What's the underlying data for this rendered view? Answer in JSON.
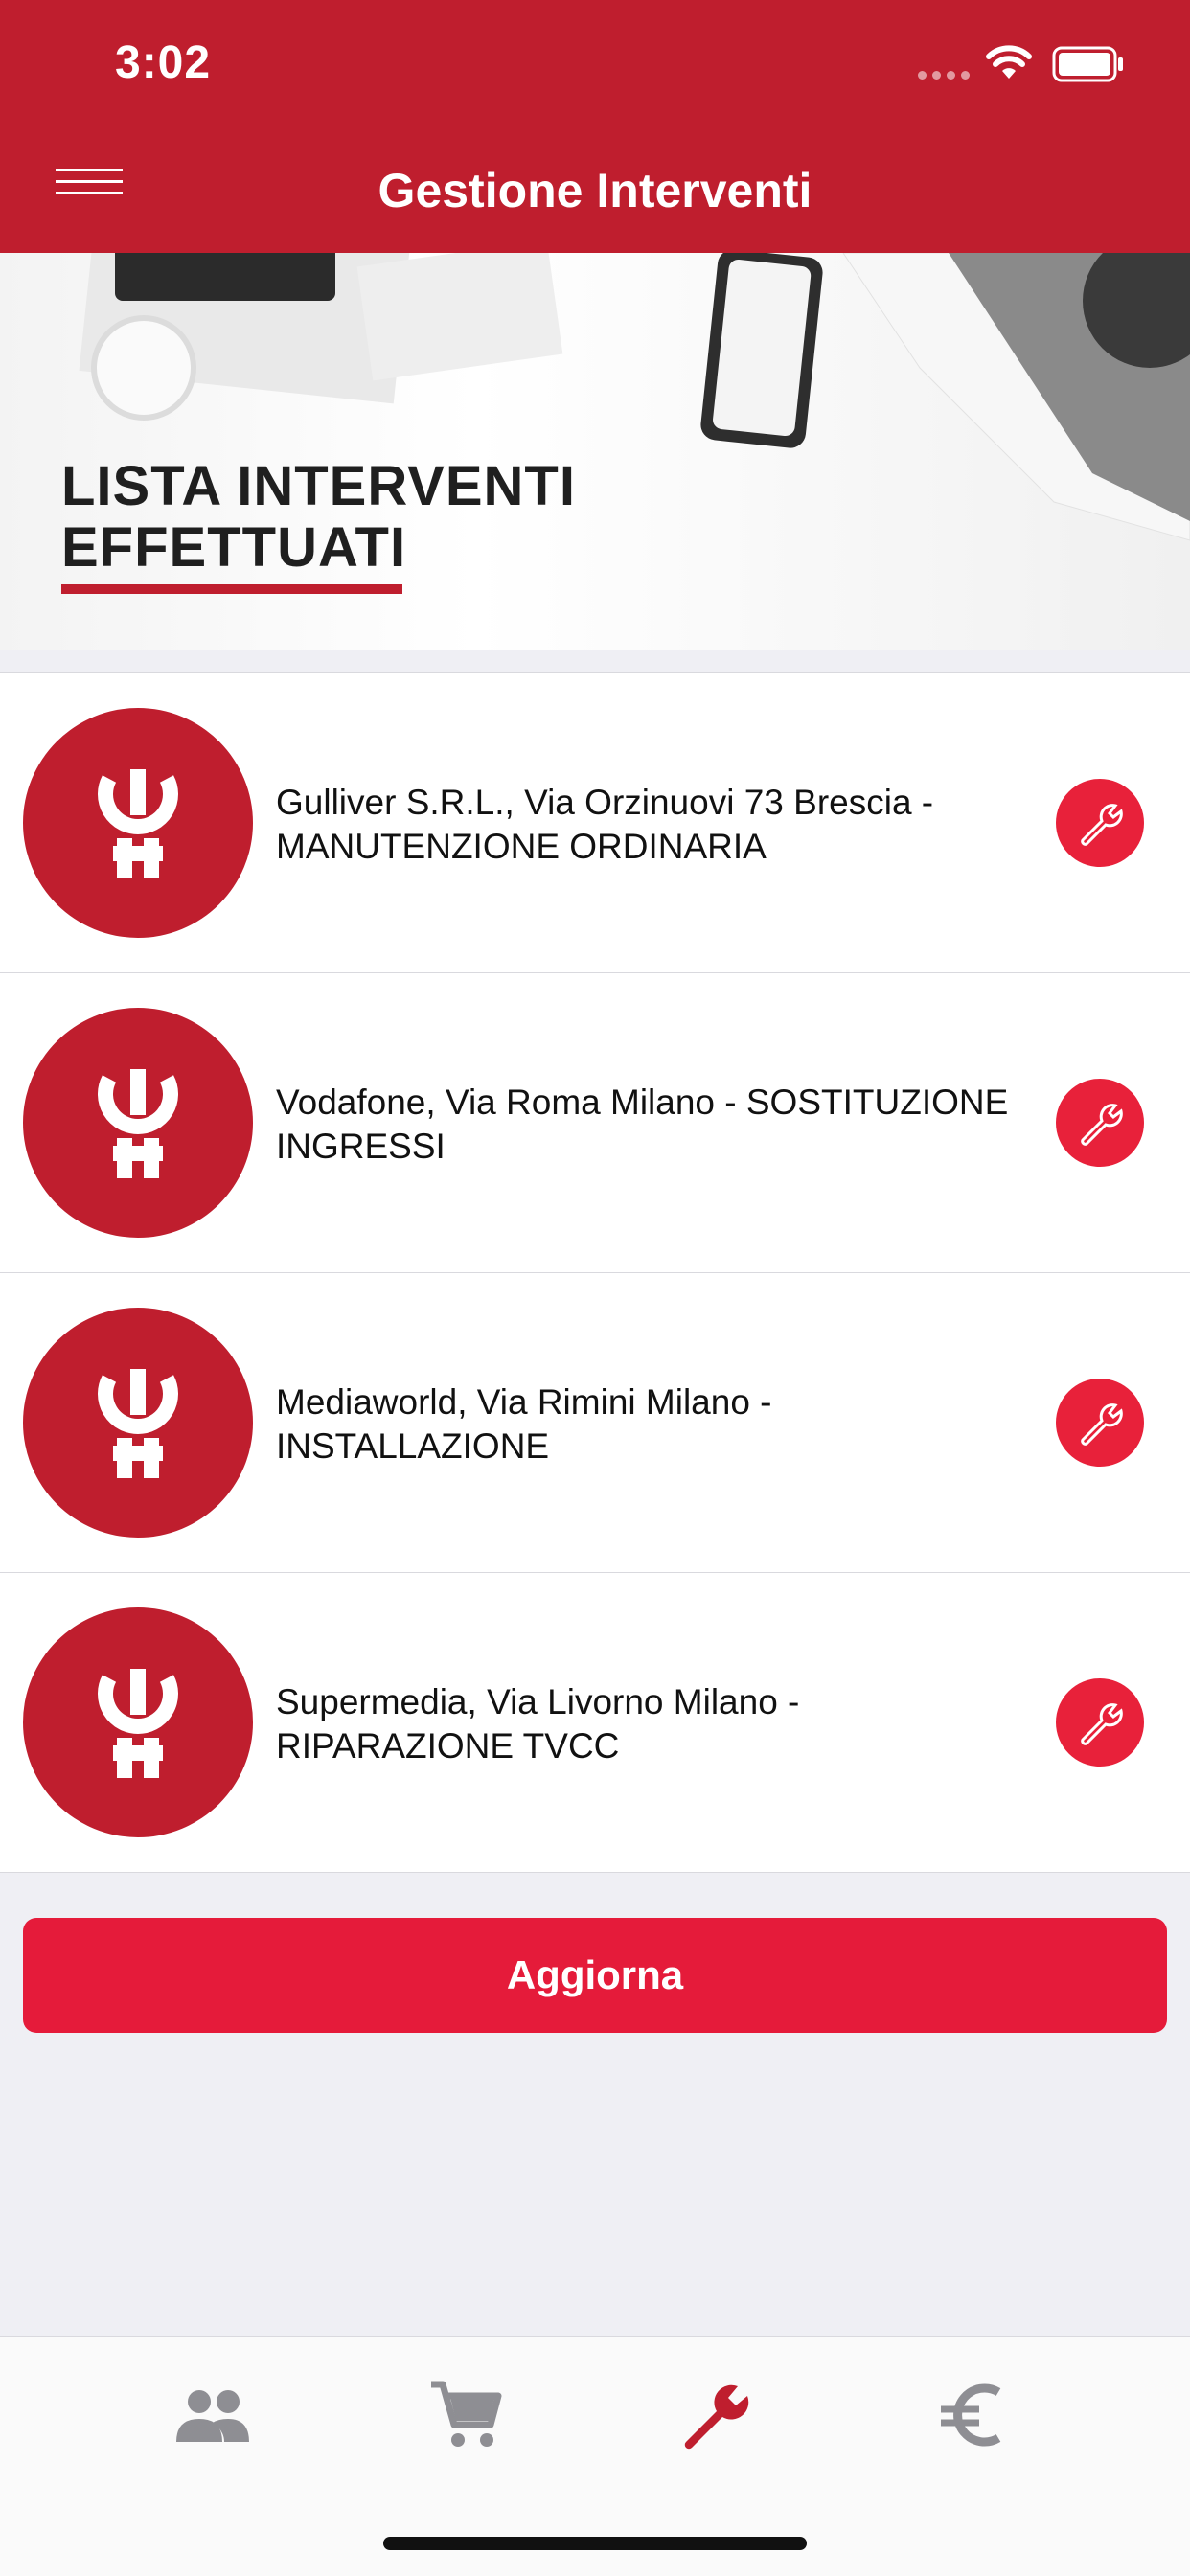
{
  "status_bar": {
    "time": "3:02"
  },
  "header": {
    "title": "Gestione Interventi",
    "menu_icon": "hamburger-menu-icon"
  },
  "banner": {
    "line1": "LISTA INTERVENTI",
    "line2": "EFFETTUATI"
  },
  "interventions": [
    {
      "text": "Gulliver S.R.L., Via Orzinuovi 73 Brescia - MANUTENZIONE ORDINARIA"
    },
    {
      "text": "Vodafone, Via Roma Milano - SOSTITUZIONE INGRESSI"
    },
    {
      "text": "Mediaworld, Via Rimini Milano - INSTALLAZIONE"
    },
    {
      "text": "Supermedia, Via Livorno Milano - RIPARAZIONE TVCC"
    }
  ],
  "refresh_button": {
    "label": "Aggiorna"
  },
  "tabs": [
    {
      "icon": "people-icon",
      "active": false
    },
    {
      "icon": "cart-icon",
      "active": false
    },
    {
      "icon": "wrench-icon",
      "active": true
    },
    {
      "icon": "euro-icon",
      "active": false
    }
  ],
  "colors": {
    "brand": "#bf1e2e",
    "button": "#e51b3a",
    "tab_inactive": "#8e8e93"
  }
}
